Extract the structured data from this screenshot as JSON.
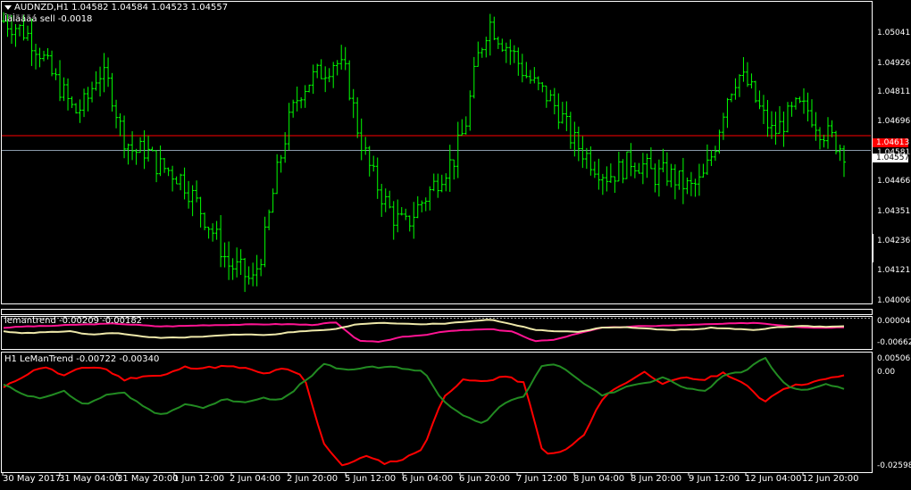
{
  "header": {
    "symbol_line": "AUDNZD,H1  1.04582 1.04584 1.04523 1.04557",
    "indicator_line": "ÎäÌäääá sell -0.0018"
  },
  "sub1": {
    "label": "lemantrend -0.00209 -0.00182"
  },
  "sub2": {
    "label": "H1 LeManTrend -0.00722 -0.00340"
  },
  "colors": {
    "background": "#000000",
    "frame": "#ffffff",
    "candle": "#00ff00",
    "red_level": "#ff0000",
    "bid_level": "#8a9aaa",
    "sub1_line_a": "#ff1493",
    "sub1_line_b": "#eee8aa",
    "sub2_line_a": "#ff0000",
    "sub2_line_b": "#228b22"
  },
  "chart_data": [
    {
      "type": "candlestick",
      "title": "AUDNZD,H1",
      "ylim": [
        1.0398,
        1.0512
      ],
      "y_ticks": [
        "1.05041",
        "1.04926",
        "1.04811",
        "1.04696",
        "1.04581",
        "1.04466",
        "1.04351",
        "1.04236",
        "1.04121",
        "1.04006"
      ],
      "levels": [
        {
          "value": 1.04613,
          "label": "1.04613",
          "color": "#ff0000"
        },
        {
          "value": 1.04557,
          "label": "1.04557",
          "color": "#8a9aaa"
        }
      ],
      "x_tick_labels": [
        "30 May 2017",
        "31 May 04:00",
        "31 May 20:00",
        "1 Jun 12:00",
        "2 Jun 04:00",
        "2 Jun 20:00",
        "5 Jun 12:00",
        "6 Jun 04:00",
        "6 Jun 20:00",
        "7 Jun 12:00",
        "8 Jun 04:00",
        "8 Jun 20:00",
        "9 Jun 12:00",
        "12 Jun 04:00",
        "12 Jun 20:00"
      ],
      "close_path": [
        1.0505,
        1.0503,
        1.05,
        1.0494,
        1.0485,
        1.0478,
        1.047,
        1.0474,
        1.0486,
        1.048,
        1.0462,
        1.0455,
        1.0456,
        1.045,
        1.0448,
        1.0445,
        1.0438,
        1.043,
        1.0422,
        1.0412,
        1.041,
        1.0405,
        1.042,
        1.0445,
        1.0465,
        1.0478,
        1.0483,
        1.0486,
        1.049,
        1.0484,
        1.0462,
        1.0448,
        1.0438,
        1.043,
        1.0427,
        1.0434,
        1.044,
        1.0447,
        1.0452,
        1.0465,
        1.049,
        1.0505,
        1.0498,
        1.0493,
        1.0485,
        1.048,
        1.0476,
        1.047,
        1.046,
        1.0455,
        1.045,
        1.0446,
        1.0448,
        1.0452,
        1.045,
        1.0446,
        1.0447,
        1.0444,
        1.0441,
        1.0444,
        1.0456,
        1.0475,
        1.0485,
        1.048,
        1.047,
        1.0462,
        1.0467,
        1.0472,
        1.0471,
        1.0464,
        1.046,
        1.04557
      ]
    },
    {
      "type": "line",
      "name": "lemantrend",
      "ylim": [
        -0.0074,
        0.0008
      ],
      "y_ticks": [
        "0.00004",
        "-0.00662"
      ],
      "series": [
        {
          "color": "#ff1493",
          "values": [
            -0.002,
            -0.0016,
            -0.0015,
            -0.0012,
            -0.001,
            -0.0008,
            -0.0012,
            -0.0016,
            -0.0015,
            -0.0013,
            -0.0012,
            -0.0011,
            -0.001,
            -0.001,
            -0.0012,
            -0.0004,
            -0.0055,
            -0.006,
            -0.0045,
            -0.004,
            -0.003,
            -0.0026,
            -0.0024,
            -0.003,
            -0.0058,
            -0.0052,
            -0.0035,
            -0.002,
            -0.0018,
            -0.0015,
            -0.0014,
            -0.0012,
            -0.001,
            -0.0008,
            -0.0006,
            -0.0012,
            -0.0018,
            -0.002,
            -0.0018
          ]
        },
        {
          "color": "#eee8aa",
          "values": [
            -0.003,
            -0.0035,
            -0.0032,
            -0.003,
            -0.004,
            -0.0034,
            -0.0042,
            -0.0048,
            -0.0047,
            -0.0045,
            -0.004,
            -0.0038,
            -0.004,
            -0.0032,
            -0.0028,
            -0.0024,
            -0.001,
            -0.0006,
            -0.0008,
            -0.001,
            -0.0008,
            -0.0002,
            0.0003,
            -0.001,
            -0.0025,
            -0.003,
            -0.0031,
            -0.002,
            -0.0018,
            -0.0022,
            -0.0026,
            -0.0025,
            -0.002,
            -0.0023,
            -0.0026,
            -0.0018,
            -0.0015,
            -0.0017,
            -0.0016
          ]
        }
      ]
    },
    {
      "type": "line",
      "name": "H1 LeManTrend",
      "ylim": [
        -0.0268,
        0.0022
      ],
      "y_ticks": [
        "0.00506",
        "0.00",
        "-0.02598"
      ],
      "series": [
        {
          "color": "#ff0000",
          "values": [
            -0.006,
            -0.003,
            -0.0005,
            -0.003,
            -0.0008,
            -0.001,
            -0.004,
            -0.003,
            -0.003,
            -0.0008,
            -0.001,
            -0.0006,
            -0.001,
            -0.0025,
            -0.0012,
            -0.003,
            -0.02,
            -0.026,
            -0.023,
            -0.025,
            -0.024,
            -0.021,
            -0.008,
            -0.004,
            -0.0045,
            -0.003,
            -0.0048,
            -0.023,
            -0.022,
            -0.018,
            -0.008,
            -0.005,
            -0.002,
            -0.005,
            -0.0035,
            -0.004,
            -0.0022,
            -0.005,
            -0.0095,
            -0.006,
            -0.005,
            -0.004,
            -0.0028
          ]
        },
        {
          "color": "#228b22",
          "values": [
            -0.005,
            -0.008,
            -0.0085,
            -0.0065,
            -0.0105,
            -0.008,
            -0.007,
            -0.011,
            -0.013,
            -0.01,
            -0.011,
            -0.009,
            -0.0095,
            -0.0085,
            -0.009,
            -0.0045,
            -0.0002,
            -0.0015,
            -0.001,
            -0.0008,
            -0.001,
            -0.002,
            -0.0095,
            -0.013,
            -0.015,
            -0.01,
            -0.008,
            0.0002,
            -0.001,
            -0.005,
            -0.008,
            -0.006,
            -0.005,
            -0.003,
            -0.006,
            -0.007,
            -0.003,
            -0.002,
            0.0018,
            -0.005,
            -0.007,
            -0.005,
            -0.006
          ]
        }
      ]
    }
  ]
}
